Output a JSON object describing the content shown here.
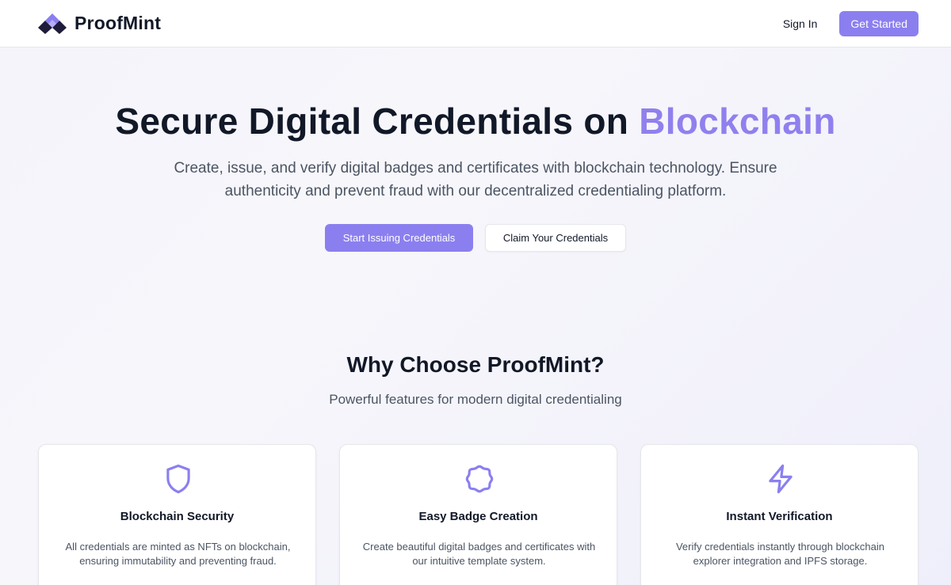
{
  "brand": {
    "name": "ProofMint",
    "logo_icon": "proofmint-logo-icon",
    "colors": {
      "dark": "#1f1b3a",
      "light": "#8b7ff0"
    }
  },
  "nav": {
    "sign_in": "Sign In",
    "get_started": "Get Started"
  },
  "hero": {
    "title_main": "Secure Digital Credentials on",
    "title_accent": "Blockchain",
    "subtitle": "Create, issue, and verify digital badges and certificates with blockchain technology. Ensure authenticity and prevent fraud with our decentralized credentialing platform.",
    "primary_button": "Start Issuing Credentials",
    "secondary_button": "Claim Your Credentials"
  },
  "features": {
    "title": "Why Choose ProofMint?",
    "subtitle": "Powerful features for modern digital credentialing",
    "cards": [
      {
        "icon": "shield-icon",
        "title": "Blockchain Security",
        "description": "All credentials are minted as NFTs on blockchain, ensuring immutability and preventing fraud."
      },
      {
        "icon": "badge-icon",
        "title": "Easy Badge Creation",
        "description": "Create beautiful digital badges and certificates with our intuitive template system."
      },
      {
        "icon": "lightning-icon",
        "title": "Instant Verification",
        "description": "Verify credentials instantly through blockchain explorer integration and IPFS storage."
      }
    ]
  },
  "colors": {
    "accent": "#8b7ff0",
    "accent_text": "#9080ee",
    "heading": "#111827",
    "body_text": "#4b5563",
    "border": "#e5e7eb"
  }
}
